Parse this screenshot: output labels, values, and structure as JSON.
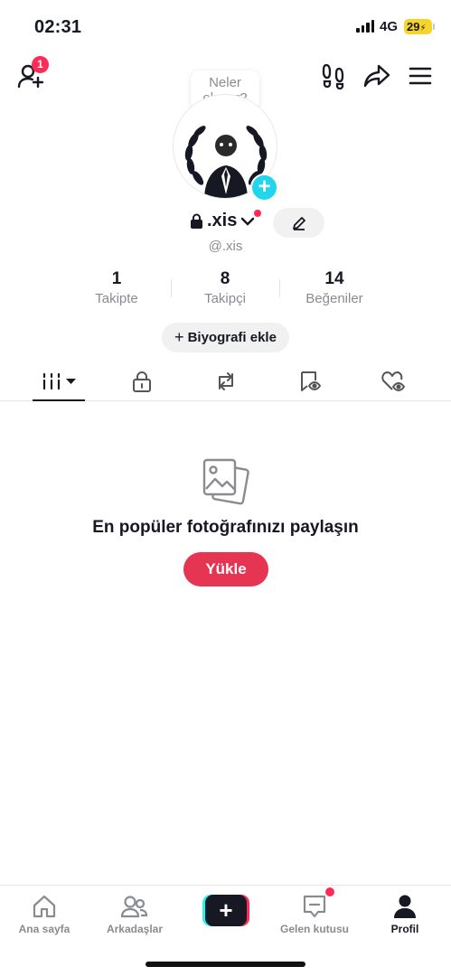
{
  "status_bar": {
    "time": "02:31",
    "network": "4G",
    "battery": "29"
  },
  "header": {
    "notification_count": "1",
    "icons": [
      "add-friend-icon",
      "footprints-icon",
      "share-icon",
      "menu-icon"
    ]
  },
  "bubble": {
    "line1": "Neler",
    "line2": "oluyor?"
  },
  "profile": {
    "username": ".xis",
    "handle": "@.xis"
  },
  "stats": [
    {
      "value": "1",
      "label": "Takipte"
    },
    {
      "value": "8",
      "label": "Takipçi"
    },
    {
      "value": "14",
      "label": "Beğeniler"
    }
  ],
  "bio_button": {
    "plus": "+",
    "label": "Biyografi ekle"
  },
  "tabs": [
    "videos-grid-icon",
    "private-lock-icon",
    "reposts-icon",
    "favorites-icon",
    "liked-icon"
  ],
  "empty_state": {
    "title": "En popüler fotoğrafınızı paylaşın",
    "button": "Yükle"
  },
  "bottom_nav": [
    {
      "label": "Ana sayfa",
      "icon": "home-icon"
    },
    {
      "label": "Arkadaşlar",
      "icon": "friends-icon"
    },
    {
      "label": "+",
      "icon": "create-icon"
    },
    {
      "label": "Gelen kutusu",
      "icon": "inbox-icon"
    },
    {
      "label": "Profil",
      "icon": "profile-icon"
    }
  ],
  "colors": {
    "accent": "#fe2c55",
    "upload": "#e63553",
    "cyan": "#20d5ec"
  }
}
